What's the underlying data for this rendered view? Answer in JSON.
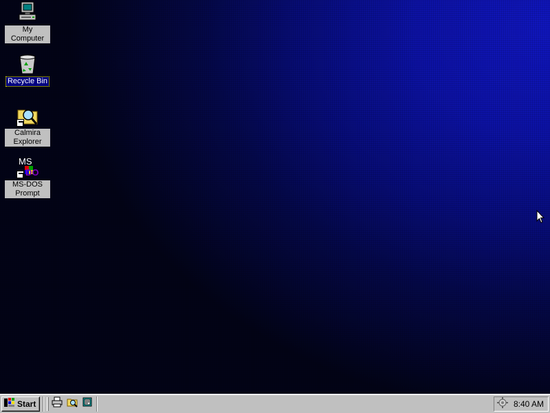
{
  "desktop": {
    "icons": [
      {
        "label": "My Computer",
        "icon": "my-computer-icon",
        "selected": false
      },
      {
        "label": "Recycle Bin",
        "icon": "recycle-bin-icon",
        "selected": true
      },
      {
        "label": "Calmira Explorer",
        "icon": "calmira-explorer-icon",
        "selected": false,
        "shortcut": true
      },
      {
        "label": "MS-DOS Prompt",
        "icon": "msdos-prompt-icon",
        "selected": false,
        "shortcut": true
      }
    ],
    "colors": {
      "background_accent": "#0c12a6",
      "background_dark": "#020316"
    }
  },
  "taskbar": {
    "start_label": "Start",
    "quick_launch": [
      "printer-icon",
      "explorer-icon",
      "notepad-icon"
    ],
    "tray_icons": [
      "network-icon"
    ],
    "clock": "8:40 AM"
  }
}
